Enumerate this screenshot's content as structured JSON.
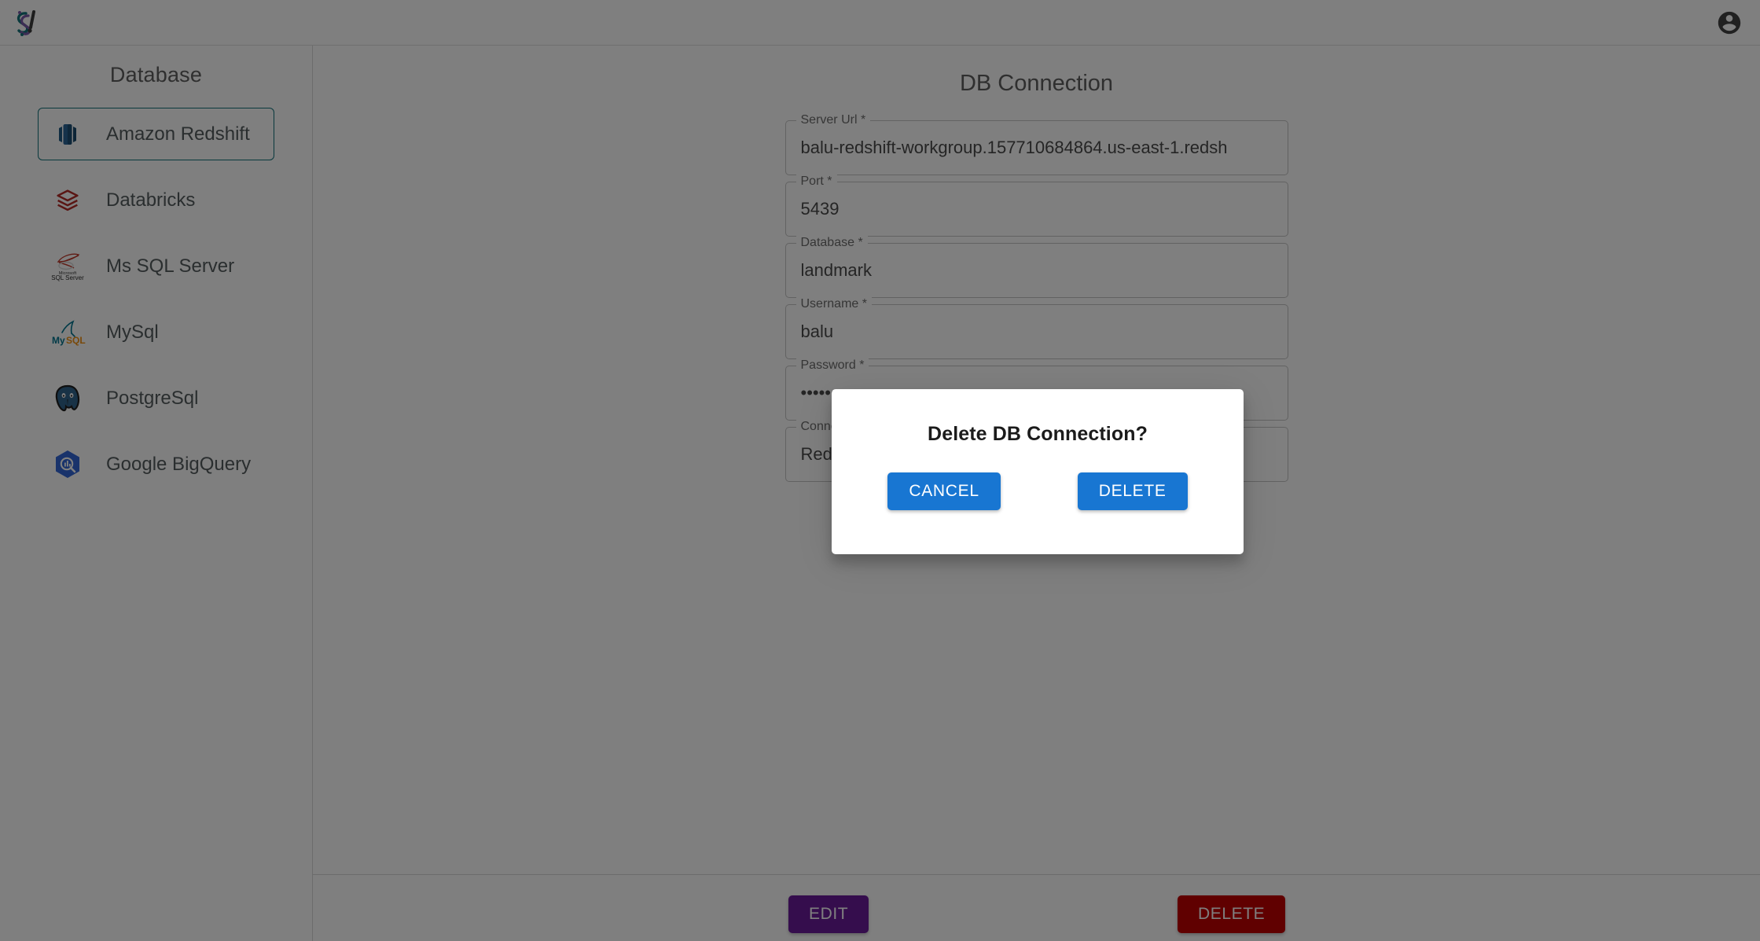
{
  "header": {
    "logo_alt": "Sigma logo",
    "account_icon": "account-circle-icon"
  },
  "sidebar": {
    "title": "Database",
    "items": [
      {
        "label": "Amazon Redshift",
        "icon": "amazon-redshift-icon",
        "selected": true
      },
      {
        "label": "Databricks",
        "icon": "databricks-icon",
        "selected": false
      },
      {
        "label": "Ms SQL Server",
        "icon": "ms-sql-server-icon",
        "selected": false
      },
      {
        "label": "MySql",
        "icon": "mysql-icon",
        "selected": false
      },
      {
        "label": "PostgreSql",
        "icon": "postgresql-icon",
        "selected": false
      },
      {
        "label": "Google BigQuery",
        "icon": "google-bigquery-icon",
        "selected": false
      }
    ]
  },
  "main": {
    "title": "DB Connection",
    "fields": [
      {
        "label": "Server Url *",
        "value": "balu-redshift-workgroup.157710684864.us-east-1.redsh"
      },
      {
        "label": "Port *",
        "value": "5439"
      },
      {
        "label": "Database *",
        "value": "landmark"
      },
      {
        "label": "Username *",
        "value": "balu"
      },
      {
        "label": "Password *",
        "value": "•••••••"
      },
      {
        "label": "Connection name *",
        "value": "Redshift Database connection"
      }
    ],
    "actions": {
      "edit_label": "EDIT",
      "delete_label": "DELETE",
      "edit_color": "#6a1b9a",
      "delete_color": "#c00000"
    }
  },
  "modal": {
    "title": "Delete DB Connection?",
    "cancel_label": "CANCEL",
    "confirm_label": "DELETE",
    "button_color": "#1876d2"
  }
}
